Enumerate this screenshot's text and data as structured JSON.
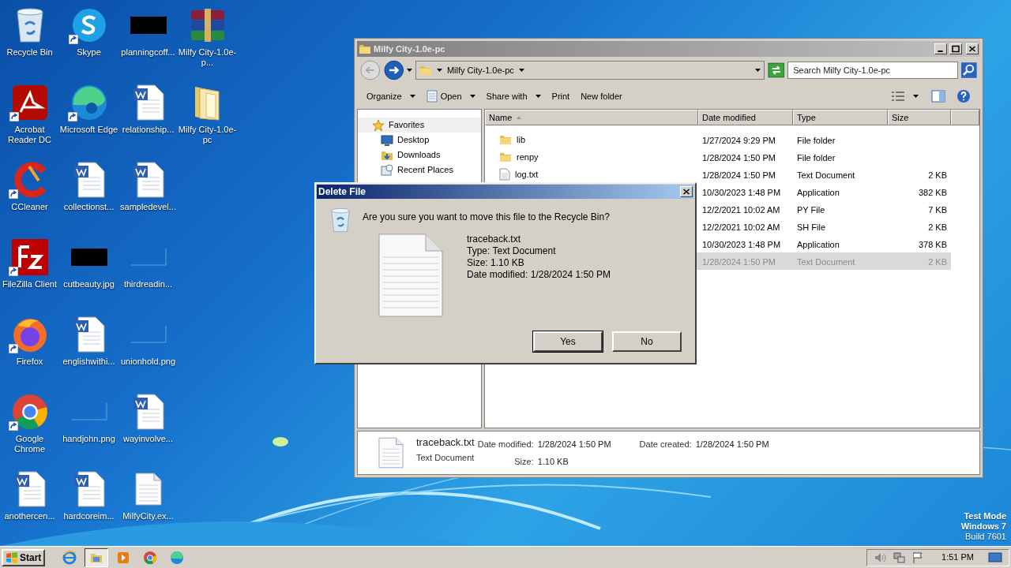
{
  "desktop": {
    "icon_rows": [
      [
        {
          "label": "Recycle Bin",
          "kind": "recycle",
          "shortcut": false
        },
        {
          "label": "Skype",
          "kind": "skype",
          "shortcut": true
        },
        {
          "label": "planningcoff...",
          "kind": "dark-thumb",
          "shortcut": false
        },
        {
          "label": "Milfy City-1.0e-p...",
          "kind": "archive",
          "shortcut": false
        }
      ],
      [
        {
          "label": "Acrobat Reader DC",
          "kind": "acrobat",
          "shortcut": true
        },
        {
          "label": "Microsoft Edge",
          "kind": "edge",
          "shortcut": true
        },
        {
          "label": "relationship...",
          "kind": "word",
          "shortcut": false
        },
        {
          "label": "Milfy City-1.0e-pc",
          "kind": "folder",
          "shortcut": false
        }
      ],
      [
        {
          "label": "CCleaner",
          "kind": "ccleaner",
          "shortcut": true
        },
        {
          "label": "collectionst...",
          "kind": "word",
          "shortcut": false
        },
        {
          "label": "sampledevel...",
          "kind": "word",
          "shortcut": false
        }
      ],
      [
        {
          "label": "FileZilla Client",
          "kind": "filezilla",
          "shortcut": true
        },
        {
          "label": "cutbeauty.jpg",
          "kind": "dark-thumb",
          "shortcut": false
        },
        {
          "label": "thirdreadin...",
          "kind": "blank-thumb",
          "shortcut": false
        }
      ],
      [
        {
          "label": "Firefox",
          "kind": "firefox",
          "shortcut": true
        },
        {
          "label": "englishwithi...",
          "kind": "word",
          "shortcut": false
        },
        {
          "label": "unionhold.png",
          "kind": "blank-thumb",
          "shortcut": false
        }
      ],
      [
        {
          "label": "Google Chrome",
          "kind": "chrome",
          "shortcut": true
        },
        {
          "label": "handjohn.png",
          "kind": "blank-thumb",
          "shortcut": false
        },
        {
          "label": "wayinvolve...",
          "kind": "word",
          "shortcut": false
        }
      ],
      [
        {
          "label": "anothercen...",
          "kind": "word",
          "shortcut": false
        },
        {
          "label": "hardcoreim...",
          "kind": "word",
          "shortcut": false
        },
        {
          "label": "MilfyCity.ex...",
          "kind": "text",
          "shortcut": false
        }
      ]
    ]
  },
  "explorer": {
    "title": "Milfy City-1.0e-pc",
    "breadcrumb": "Milfy City-1.0e-pc",
    "search": {
      "placeholder": "Search Milfy City-1.0e-pc"
    },
    "toolbar": [
      {
        "label": "Organize",
        "kind": "menu"
      },
      {
        "label": "Open",
        "kind": "menu-icon"
      },
      {
        "label": "Share with",
        "kind": "menu"
      },
      {
        "label": "Print",
        "kind": "plain"
      },
      {
        "label": "New folder",
        "kind": "plain"
      }
    ],
    "nav": [
      {
        "label": "Favorites",
        "kind": "star",
        "selected": true,
        "children": [
          {
            "label": "Desktop",
            "kind": "desktop",
            "selected": false
          },
          {
            "label": "Downloads",
            "kind": "downloads",
            "selected": false
          },
          {
            "label": "Recent Places",
            "kind": "recent",
            "selected": false
          }
        ]
      }
    ],
    "columns": [
      "Name",
      "Date modified",
      "Type",
      "Size"
    ],
    "rows": [
      {
        "name": "lib",
        "kind": "folder",
        "date": "1/27/2024 9:29 PM",
        "type": "File folder",
        "selected": false
      },
      {
        "name": "renpy",
        "kind": "folder",
        "date": "1/28/2024 1:50 PM",
        "type": "File folder",
        "selected": false
      },
      {
        "name": "log.txt",
        "kind": "text",
        "date": "1/28/2024 1:50 PM",
        "type": "Text Document",
        "size": "2 KB",
        "selected": false
      },
      {
        "date": "10/30/2023 1:48 PM",
        "type": "Application",
        "size": "382 KB",
        "selected": false
      },
      {
        "date": "12/2/2021 10:02 AM",
        "type": "PY File",
        "size": "7 KB",
        "selected": false
      },
      {
        "date": "12/2/2021 10:02 AM",
        "type": "SH File",
        "size": "2 KB",
        "selected": false
      },
      {
        "date": "10/30/2023 1:48 PM",
        "type": "Application",
        "size": "378 KB",
        "selected": false
      },
      {
        "date": "1/28/2024 1:50 PM",
        "type": "Text Document",
        "size": "2 KB",
        "selected": true
      }
    ],
    "details": {
      "name": "traceback.txt",
      "type": "Text Document",
      "field_columns": [
        [
          {
            "label": "Date modified:",
            "value": "1/28/2024 1:50 PM"
          },
          {
            "label": "Size:",
            "value": "1.10 KB"
          }
        ],
        [
          {
            "label": "Date created:",
            "value": "1/28/2024 1:50 PM"
          }
        ]
      ]
    }
  },
  "dialog": {
    "title": "Delete File",
    "question": "Are you sure you want to move this file to the Recycle Bin?",
    "file_lines": [
      "traceback.txt",
      "Type: Text Document",
      "Size: 1.10 KB",
      "Date modified: 1/28/2024 1:50 PM"
    ],
    "buttons": [
      {
        "label": "Yes",
        "default": true
      },
      {
        "label": "No",
        "default": false
      }
    ]
  },
  "taskbar": {
    "start": "Start",
    "apps": [
      {
        "kind": "ie",
        "active": false
      },
      {
        "kind": "explorer",
        "active": true
      },
      {
        "kind": "media",
        "active": false
      },
      {
        "kind": "chrome",
        "active": false
      },
      {
        "kind": "edge",
        "active": false
      }
    ],
    "tray": [
      {
        "kind": "speaker"
      },
      {
        "kind": "network"
      },
      {
        "kind": "flag"
      }
    ],
    "time": "1:51 PM"
  },
  "system_note": [
    {
      "text": "Test Mode",
      "bold": true
    },
    {
      "text": "Windows 7",
      "bold": true
    },
    {
      "text": "Build 7601",
      "bold": false
    }
  ]
}
